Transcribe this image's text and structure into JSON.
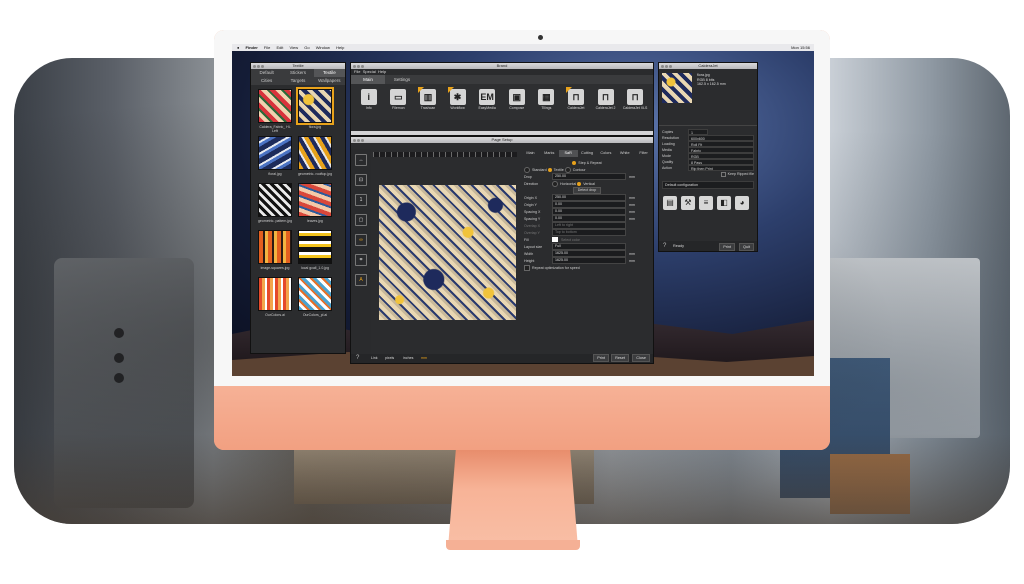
{
  "menubar": {
    "apple": "",
    "items": [
      "Finder",
      "File",
      "Edit",
      "View",
      "Go",
      "Window",
      "Help"
    ],
    "clock": "Mon 15:56"
  },
  "textile": {
    "title": "Textile",
    "tabs_row1": [
      "Default",
      "Stickers",
      "Textile"
    ],
    "tabs_row2": [
      "Cities",
      "Targets",
      "Wallpapers"
    ],
    "thumbs": [
      {
        "label": "Caldera_Fabric_\nHi-Left"
      },
      {
        "label": "flora.jpg"
      },
      {
        "label": "floral.jpg"
      },
      {
        "label": "geometric-\nrooftop.jpg"
      },
      {
        "label": "geometric-\npattern.jpg"
      },
      {
        "label": "leaves.jpg"
      },
      {
        "label": "image-squares.jpg"
      },
      {
        "label": "local gcall_1.0.jpg"
      },
      {
        "label": "OurColors.ai"
      },
      {
        "label": "OurColors_pl.ai"
      }
    ]
  },
  "caldera_main": {
    "title": "Brand",
    "menu": [
      "File",
      "Special",
      "Help"
    ],
    "tabs": [
      "Main",
      "Settings"
    ],
    "tools": [
      "Info",
      "Filemon",
      "Trashcan",
      "Workflow",
      "EasyMedia",
      "Compose",
      "Tilings",
      "CalderaJet",
      "CalderaJet 2",
      "CalderaJet XLS"
    ]
  },
  "page_setup": {
    "title": "Page Setup",
    "tabs": [
      "Main",
      "Marks",
      "SaR",
      "Cutting",
      "Colors",
      "White",
      "Filter"
    ],
    "section": "Step & Repeat",
    "mode_options": [
      "Standard",
      "Textile",
      "Contour"
    ],
    "drop_label": "Drop",
    "drop_value": "250.00",
    "direction_label": "Direction",
    "direction_options": [
      "Horizontal",
      "Vertical"
    ],
    "detect_drop": "Detect drop",
    "origin_x": {
      "label": "Origin X",
      "value": "250.00"
    },
    "origin_y": {
      "label": "Origin Y",
      "value": "0.00"
    },
    "spacing_x": {
      "label": "Spacing X",
      "value": "0.00"
    },
    "spacing_y": {
      "label": "Spacing Y",
      "value": "0.00"
    },
    "overlap_x": {
      "label": "Overlap X",
      "value": "Left to right"
    },
    "overlap_y": {
      "label": "Overlap Y",
      "value": "Top to bottom"
    },
    "fill_label": "Fill",
    "fill_value": "Select color",
    "layout_size": {
      "label": "Layout size",
      "value": "Full"
    },
    "width": {
      "label": "Width",
      "value": "1625.00"
    },
    "height": {
      "label": "Height",
      "value": "1625.00"
    },
    "repeat_opt": "Repeat optimization for speed",
    "unit": "mm",
    "footer_link": "Link",
    "footer_options": [
      "pixels",
      "inches",
      "mm"
    ],
    "buttons": [
      "Print",
      "Reset",
      "Close"
    ]
  },
  "caldera_right": {
    "title": "CalderaJet",
    "file": {
      "name": "flora.jpg",
      "size": "RGB 8 bits",
      "dims": "162.5 x 162.5 mm"
    },
    "fields": [
      {
        "k": "Copies",
        "v": "1"
      },
      {
        "k": "Resolution",
        "v": "600x600"
      },
      {
        "k": "Loading",
        "v": "Roll Fit"
      },
      {
        "k": "Media",
        "v": "Fabric"
      },
      {
        "k": "Mode",
        "v": "RGB"
      },
      {
        "k": "Quality",
        "v": "8 Pass"
      },
      {
        "k": "Action",
        "v": "Rip then Print"
      }
    ],
    "keep_ripped": "Keep Ripped file",
    "config": "Default configuration",
    "status": "Ready",
    "buttons": [
      "Print",
      "Quit"
    ]
  }
}
